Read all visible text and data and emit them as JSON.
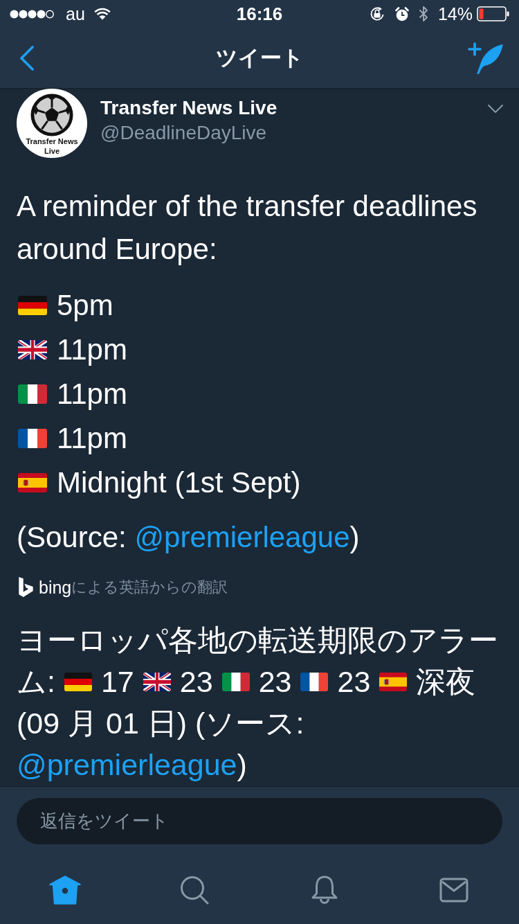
{
  "status_bar": {
    "carrier": "au",
    "time": "16:16",
    "battery": "14%"
  },
  "nav": {
    "title": "ツイート"
  },
  "tweet": {
    "avatar_lines": [
      "Transfer News",
      "Live"
    ],
    "name": "Transfer News Live",
    "handle": "@DeadlineDayLive",
    "text": "A reminder of the transfer deadlines around Europe:",
    "deadlines": [
      {
        "kind": "germany",
        "time": "5pm"
      },
      {
        "kind": "uk",
        "time": "11pm"
      },
      {
        "kind": "italy",
        "time": "11pm"
      },
      {
        "kind": "france",
        "time": "11pm"
      },
      {
        "kind": "spain",
        "time": "Midnight (1st Sept)"
      }
    ],
    "source": {
      "prefix": "(Source: ",
      "link": "@premierleague",
      "suffix": ")"
    },
    "translation_credit": {
      "brand": "bing",
      "text": "による英語からの翻訳"
    },
    "translation_lines": [
      [
        {
          "kind": "text",
          "text": "ヨーロッパ各地の転送期限のアラー"
        }
      ],
      [
        {
          "kind": "text",
          "text": "ム:"
        },
        {
          "kind": "germany"
        },
        {
          "kind": "text",
          "text": "17"
        },
        {
          "kind": "uk"
        },
        {
          "kind": "text",
          "text": "23"
        },
        {
          "kind": "italy"
        },
        {
          "kind": "text",
          "text": "23"
        },
        {
          "kind": "france"
        },
        {
          "kind": "text",
          "text": "23"
        },
        {
          "kind": "spain"
        },
        {
          "kind": "text",
          "text": "深夜"
        }
      ],
      [
        {
          "kind": "text",
          "text": "(09 月 01 日) (ソース:"
        }
      ],
      [
        {
          "kind": "link",
          "text": "@premierleague"
        },
        {
          "kind": "text",
          "text": ")"
        }
      ]
    ]
  },
  "reply": {
    "placeholder": "返信をツイート"
  },
  "tabs": [
    {
      "kind": "home",
      "selected": true
    },
    {
      "kind": "search",
      "selected": false
    },
    {
      "kind": "notifications",
      "selected": false
    },
    {
      "kind": "messages",
      "selected": false
    }
  ]
}
